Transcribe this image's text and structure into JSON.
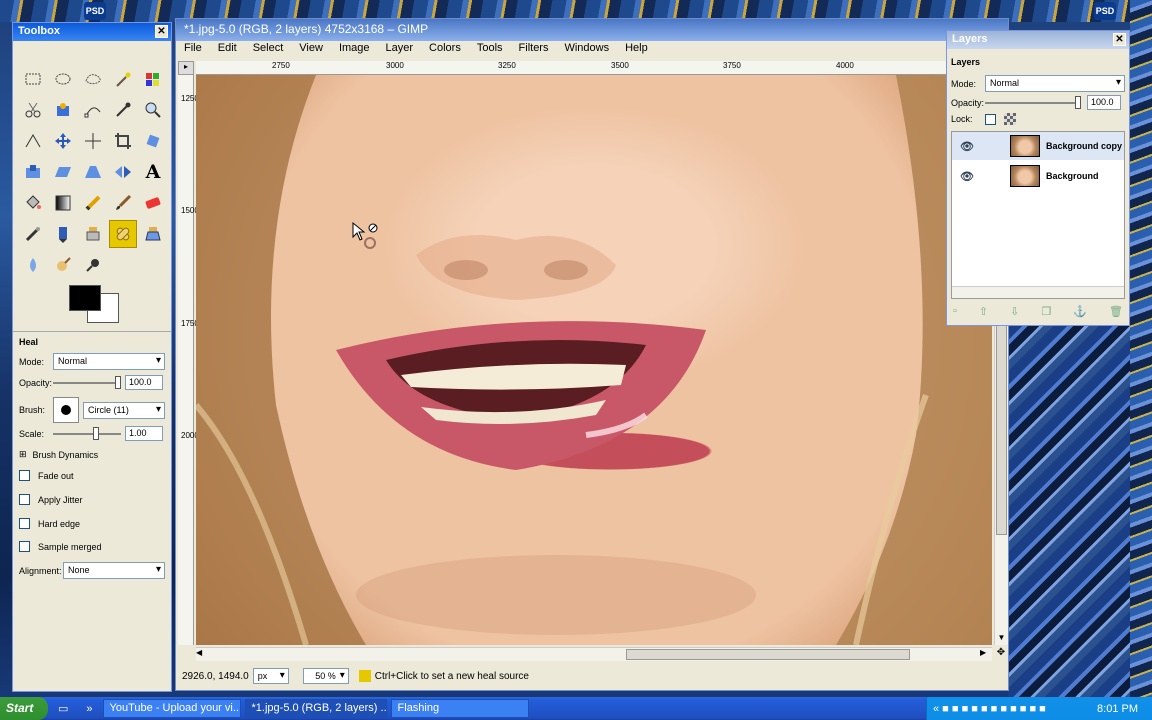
{
  "desktop": {
    "icon_label": "PSD"
  },
  "toolbox": {
    "title": "Toolbox",
    "tools": [
      "rect-select",
      "ellipse-select",
      "free-select",
      "fuzzy-select",
      "select-by-color",
      "scissors",
      "foreground-select",
      "paths",
      "color-picker",
      "zoom",
      "measure",
      "move",
      "align",
      "crop",
      "rotate",
      "scale",
      "shear",
      "perspective",
      "flip",
      "text",
      "bucket-fill",
      "blend",
      "pencil",
      "paintbrush",
      "eraser",
      "airbrush",
      "ink",
      "clone",
      "heal",
      "perspective-clone",
      "blur",
      "smudge",
      "dodge-burn"
    ],
    "text_tool_glyph": "A",
    "options": {
      "title": "Heal",
      "mode_label": "Mode:",
      "mode_value": "Normal",
      "opacity_label": "Opacity:",
      "opacity_value": "100.0",
      "opacity_fraction": 1.0,
      "brush_label": "Brush:",
      "brush_value": "Circle (11)",
      "scale_label": "Scale:",
      "scale_value": "1.00",
      "brush_dynamics": "Brush Dynamics",
      "fade_out": "Fade out",
      "apply_jitter": "Apply Jitter",
      "hard_edge": "Hard edge",
      "sample_merged": "Sample merged",
      "alignment_label": "Alignment:",
      "alignment_value": "None"
    }
  },
  "gimp": {
    "title": "*1.jpg-5.0 (RGB, 2 layers) 4752x3168 – GIMP",
    "menu": [
      "File",
      "Edit",
      "Select",
      "View",
      "Image",
      "Layer",
      "Colors",
      "Tools",
      "Filters",
      "Windows",
      "Help"
    ],
    "ruler_h": [
      "2750",
      "3000",
      "3250",
      "3500",
      "3750",
      "4000"
    ],
    "ruler_v": [
      "1250",
      "1500",
      "1750",
      "2000"
    ],
    "status": {
      "coords": "2926.0, 1494.0",
      "unit": "px",
      "zoom": "50 %",
      "message": "Ctrl+Click to set a new heal source"
    }
  },
  "layers": {
    "title": "Layers",
    "header": "Layers",
    "mode_label": "Mode:",
    "mode_value": "Normal",
    "opacity_label": "Opacity:",
    "opacity_value": "100.0",
    "lock_label": "Lock:",
    "items": [
      {
        "name": "Background copy",
        "selected": true
      },
      {
        "name": "Background",
        "selected": false
      }
    ]
  },
  "taskbar": {
    "start": "Start",
    "tasks": [
      "YouTube - Upload your vi...",
      "*1.jpg-5.0 (RGB, 2 layers) ...",
      "Flashing"
    ],
    "clock": "8:01 PM"
  }
}
